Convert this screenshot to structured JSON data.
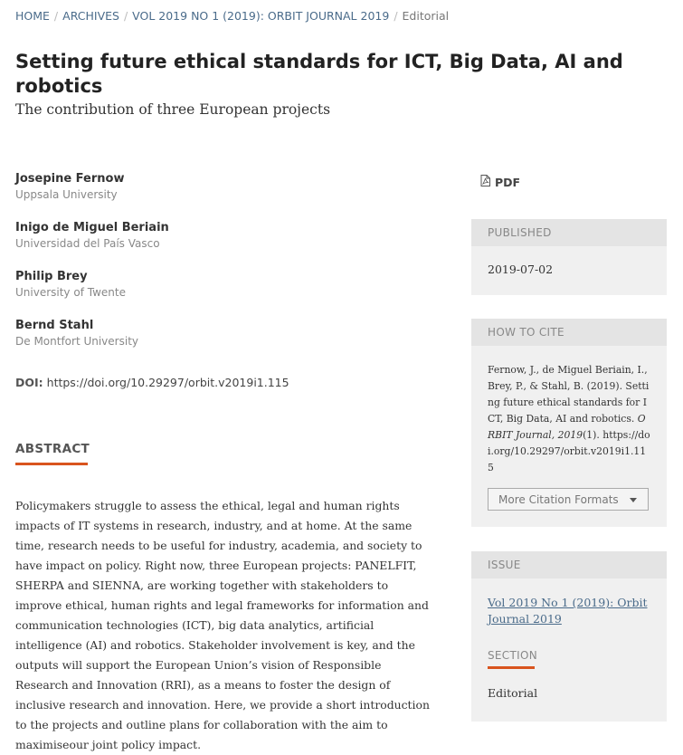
{
  "breadcrumb": {
    "items": [
      "HOME",
      "ARCHIVES",
      "VOL 2019 NO 1 (2019): ORBIT JOURNAL 2019"
    ],
    "current": "Editorial"
  },
  "article": {
    "title": "Setting future ethical standards for ICT, Big Data, AI and robotics",
    "subtitle": "The contribution of three European projects",
    "authors": [
      {
        "name": "Josepine Fernow",
        "affiliation": "Uppsala University"
      },
      {
        "name": "Inigo de Miguel Beriain",
        "affiliation": "Universidad del País Vasco"
      },
      {
        "name": "Philip Brey",
        "affiliation": "University of Twente"
      },
      {
        "name": "Bernd Stahl",
        "affiliation": "De Montfort University"
      }
    ],
    "doi_label": "DOI:",
    "doi": "https://doi.org/10.29297/orbit.v2019i1.115",
    "abstract_heading": "ABSTRACT",
    "abstract": "Policymakers struggle to assess the ethical, legal and human rights impacts of IT systems in research, industry, and at home. At the same time, research needs to be useful for industry, academia, and society to have impact on policy. Right now, three European projects: PANELFIT, SHERPA and SIENNA, are working together with stakeholders to improve ethical, human rights and legal frameworks for information and communication technologies (ICT), big data analytics, artificial intelligence (AI) and robotics. Stakeholder involvement is key, and the outputs will support the European Union’s vision of Responsible Research and Innovation (RRI), as a means to foster the design of inclusive research and innovation. Here, we provide a short introduction to the projects and outline plans for collaboration with the aim to maximiseour joint policy impact."
  },
  "sidebar": {
    "pdf_label": "PDF",
    "published": {
      "heading": "PUBLISHED",
      "date": "2019-07-02"
    },
    "cite": {
      "heading": "HOW TO CITE",
      "text_plain": "Fernow, J., de Miguel Beriain, I., Brey, P., & Stahl, B. (2019). Setting future ethical standards for ICT, Big Data, AI and robotics. ",
      "journal": "ORBIT Journal",
      "volume": ", 2019",
      "issue": "(1). https://doi.org/10.29297/orbit.v2019i1.115",
      "more_formats": "More Citation Formats"
    },
    "issue": {
      "heading": "ISSUE",
      "link": "Vol 2019 No 1 (2019): Orbit Journal 2019"
    },
    "section": {
      "heading": "SECTION",
      "value": "Editorial"
    }
  },
  "colors": {
    "accent": "#d9541e",
    "link": "#4a6b8a",
    "panel_bg": "#f0f0f0",
    "panel_head": "#e4e4e4"
  }
}
